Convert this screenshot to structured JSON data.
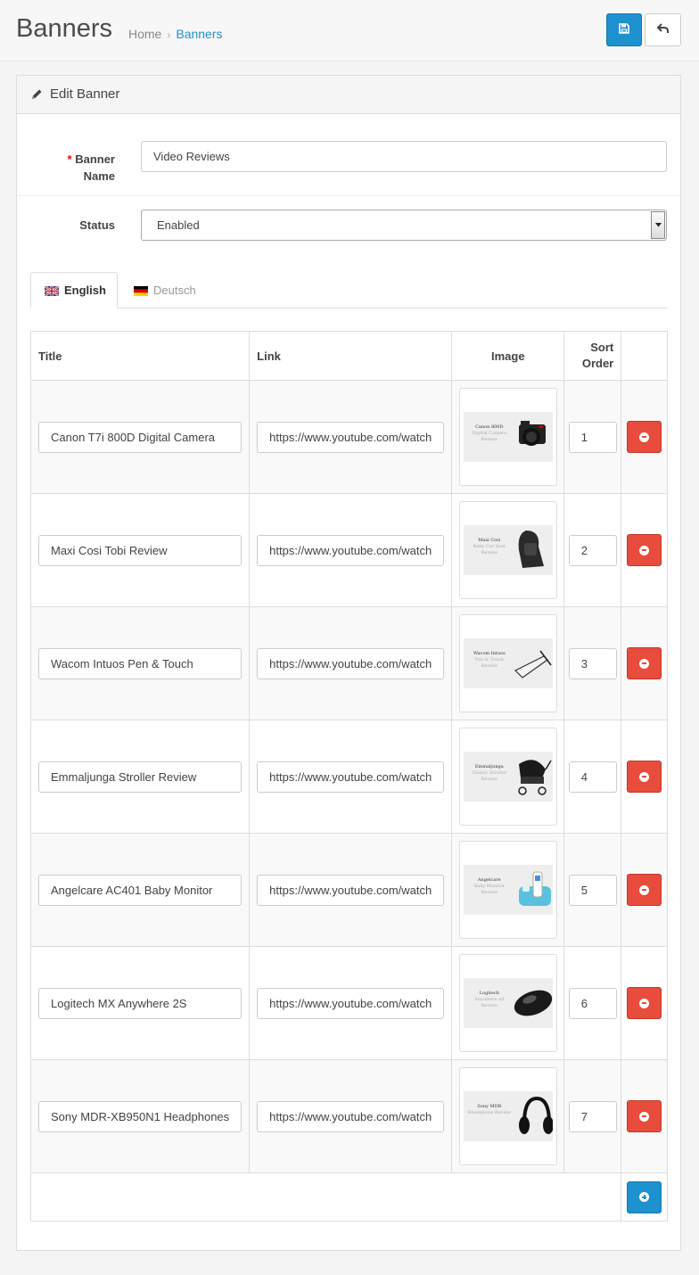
{
  "header": {
    "title": "Banners",
    "breadcrumb": [
      {
        "label": "Home"
      },
      {
        "label": "Banners"
      }
    ],
    "breadcrumb_separator": "›",
    "save_icon": "floppy-disk-icon",
    "back_icon": "reply-arrow-icon"
  },
  "panel": {
    "title": "Edit Banner",
    "title_icon": "pencil-icon"
  },
  "form": {
    "banner_name_label": "Banner Name",
    "required_mark": "*",
    "banner_name_value": "Video Reviews",
    "status_label": "Status",
    "status_value": "Enabled"
  },
  "tabs": [
    {
      "label": "English",
      "active": true,
      "icon": "flag-uk-icon"
    },
    {
      "label": "Deutsch",
      "active": false,
      "icon": "flag-de-icon"
    }
  ],
  "table": {
    "headers": {
      "title": "Title",
      "link": "Link",
      "image": "Image",
      "sort_order": "Sort Order"
    },
    "rows": [
      {
        "title": "Canon T7i 800D Digital Camera",
        "link": "https://www.youtube.com/watch",
        "image_caption": "Canon 800D",
        "image_sub": "Digital Camera Review",
        "sort": "1"
      },
      {
        "title": "Maxi Cosi Tobi Review",
        "link": "https://www.youtube.com/watch",
        "image_caption": "Maxi Cosi",
        "image_sub": "Baby Car Seat Review",
        "sort": "2"
      },
      {
        "title": "Wacom Intuos Pen & Touch",
        "link": "https://www.youtube.com/watch",
        "image_caption": "Wacom Intuos",
        "image_sub": "Pen & Touch Review",
        "sort": "3"
      },
      {
        "title": "Emmaljunga Stroller Review",
        "link": "https://www.youtube.com/watch",
        "image_caption": "Emmaljunga",
        "image_sub": "Classic Stroller Review",
        "sort": "4"
      },
      {
        "title": "Angelcare AC401 Baby Monitor",
        "link": "https://www.youtube.com/watch",
        "image_caption": "Angelcare",
        "image_sub": "Baby Monitor Review",
        "sort": "5"
      },
      {
        "title": "Logitech MX Anywhere 2S",
        "link": "https://www.youtube.com/watch",
        "image_caption": "Logitech",
        "image_sub": "Anywhere all Review",
        "sort": "6"
      },
      {
        "title": "Sony MDR-XB950N1 Headphones",
        "link": "https://www.youtube.com/watch",
        "image_caption": "Sony MDR",
        "image_sub": "Headphone Review",
        "sort": "7"
      }
    ],
    "remove_icon": "minus-circle-icon",
    "add_icon": "plus-circle-icon"
  },
  "colors": {
    "primary": "#1e91cf",
    "danger": "#e74c3c",
    "required": "#ff0000"
  }
}
